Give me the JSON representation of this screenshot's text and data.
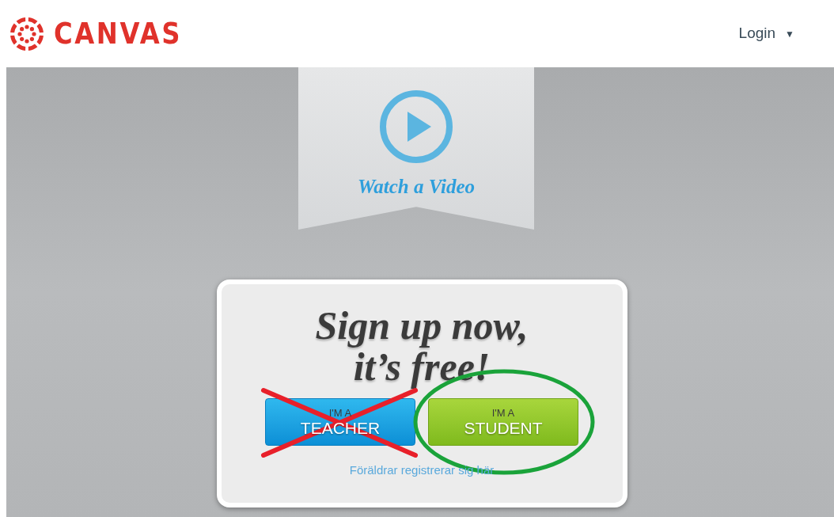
{
  "header": {
    "logo": "CANVAS",
    "login": {
      "label": "Login",
      "caret": "▼"
    }
  },
  "video_ribbon": {
    "label": "Watch a Video"
  },
  "signup_card": {
    "heading": [
      "Sign up now,",
      "it’s free!"
    ],
    "buttons": [
      {
        "kind": "teacher",
        "line1": "I'M A",
        "line2": "TEACHER",
        "mark": {
          "kind": "cross"
        }
      },
      {
        "kind": "student",
        "line1": "I'M A",
        "line2": "STUDENT",
        "mark": {
          "kind": "circle"
        }
      }
    ],
    "parent_link": "Föräldrar registrerar sig här"
  }
}
